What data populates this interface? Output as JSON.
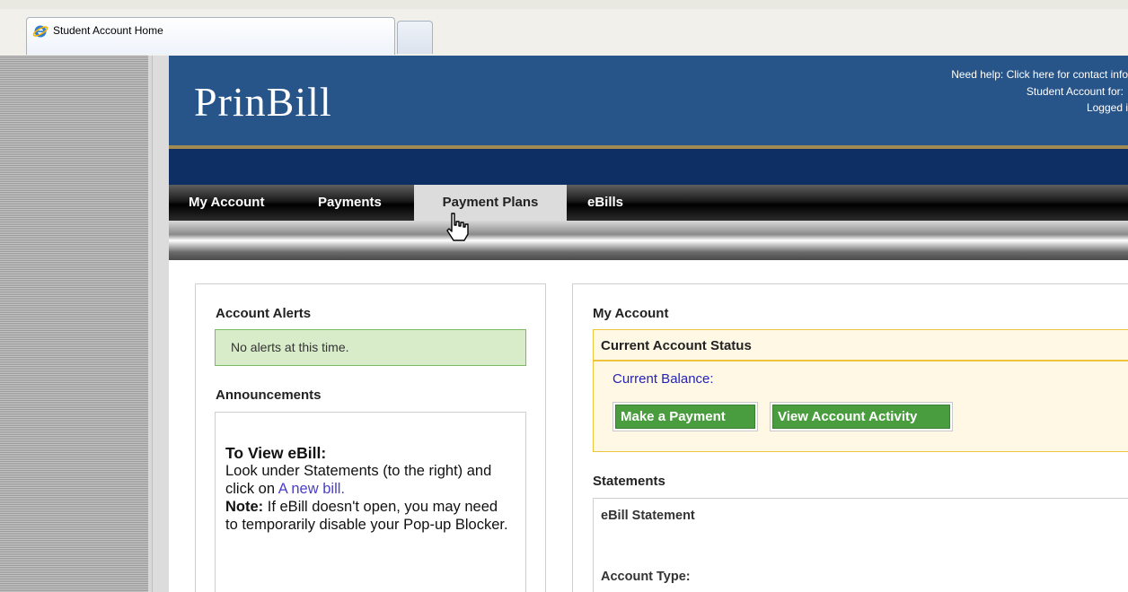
{
  "browser": {
    "tab_title": "Student Account Home"
  },
  "header": {
    "logo": "PrinBill",
    "help_text": "Need help: Click here for contact info",
    "student_account_label": "Student Account for:",
    "logged_in_label": "Logged i"
  },
  "nav": {
    "items": [
      {
        "label": "My Account"
      },
      {
        "label": "Payments"
      },
      {
        "label": "Payment Plans",
        "active": true
      },
      {
        "label": "eBills"
      }
    ]
  },
  "left_panel": {
    "alerts_title": "Account Alerts",
    "alerts_text": "No alerts at this time.",
    "announcements_title": "Announcements",
    "announcement": {
      "heading": "To View eBill:",
      "text1": "Look under Statements (to the right) and click on ",
      "link": "A new bill.",
      "note_label": "Note:",
      "text2": " If eBill doesn't open, you may need to temporarily disable your Pop-up Blocker."
    }
  },
  "right_panel": {
    "title": "My Account",
    "status_title": "Current Account Status",
    "balance_label": "Current Balance:",
    "make_payment_label": "Make a Payment",
    "view_activity_label": "View Account Activity",
    "statements_title": "Statements",
    "ebill_statement_label": "eBill Statement",
    "account_type_label": "Account Type:"
  },
  "colors": {
    "header_blue": "#275589",
    "navy_band": "#0d2f63",
    "gold_rule": "#a18a53",
    "alert_green": "#d8ecc9",
    "button_green": "#4a9d3f",
    "status_bg": "#fff8e4",
    "status_border": "#ecc43e",
    "balance_text": "#2323b7"
  }
}
